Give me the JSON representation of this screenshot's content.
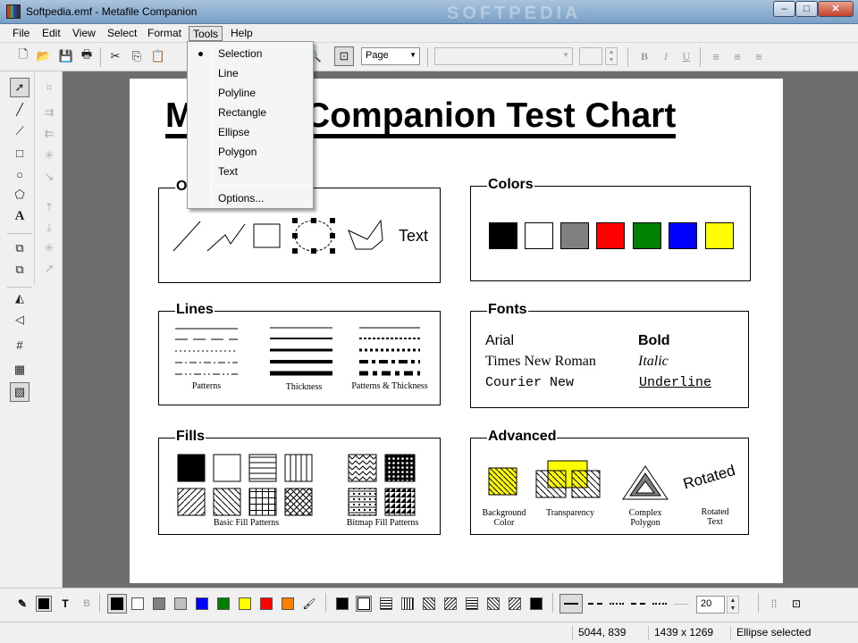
{
  "window": {
    "title": "Softpedia.emf - Metafile Companion",
    "watermark": "SOFTPEDIA",
    "min": "–",
    "max": "□",
    "close": "✕"
  },
  "menubar": {
    "file": "File",
    "edit": "Edit",
    "view": "View",
    "select": "Select",
    "format": "Format",
    "tools": "Tools",
    "help": "Help"
  },
  "tools_menu": {
    "items": [
      "Selection",
      "Line",
      "Polyline",
      "Rectangle",
      "Ellipse",
      "Polygon",
      "Text"
    ],
    "options": "Options...",
    "checked": "Selection"
  },
  "toolbar": {
    "zoom_value": "Page",
    "font_value": "",
    "bold": "B",
    "italic": "I",
    "underline": "U"
  },
  "chart": {
    "title": "Metafile Companion Test Chart",
    "objects": {
      "title": "Objects",
      "text_sample": "Text"
    },
    "colors": {
      "title": "Colors",
      "swatches": [
        "#000000",
        "#ffffff",
        "#808080",
        "#ff0000",
        "#008000",
        "#0000ff",
        "#ffff00"
      ]
    },
    "lines": {
      "title": "Lines",
      "cap_patterns": "Patterns",
      "cap_thickness": "Thickness",
      "cap_both": "Patterns & Thickness"
    },
    "fonts": {
      "title": "Fonts",
      "arial": "Arial",
      "times": "Times New Roman",
      "courier": "Courier New",
      "bold": "Bold",
      "italic": "Italic",
      "underline": "Underline"
    },
    "fills": {
      "title": "Fills",
      "cap_basic": "Basic Fill Patterns",
      "cap_bitmap": "Bitmap Fill Patterns"
    },
    "advanced": {
      "title": "Advanced",
      "cap_bg1": "Background",
      "cap_bg2": "Color",
      "cap_tr": "Transparency",
      "cap_cp1": "Complex",
      "cap_cp2": "Polygon",
      "cap_rt1": "Rotated",
      "cap_rt2": "Text",
      "rotated_text": "Rotated"
    }
  },
  "bottom": {
    "colors": [
      "#000000",
      "#ffffff",
      "#808080",
      "#c0c0c0",
      "#0000ff",
      "#008000",
      "#ffff00",
      "#ff0000",
      "#ff8000"
    ],
    "line_width": "20"
  },
  "status": {
    "coords": "5044, 839",
    "size": "1439 x 1269",
    "message": "Ellipse selected"
  }
}
